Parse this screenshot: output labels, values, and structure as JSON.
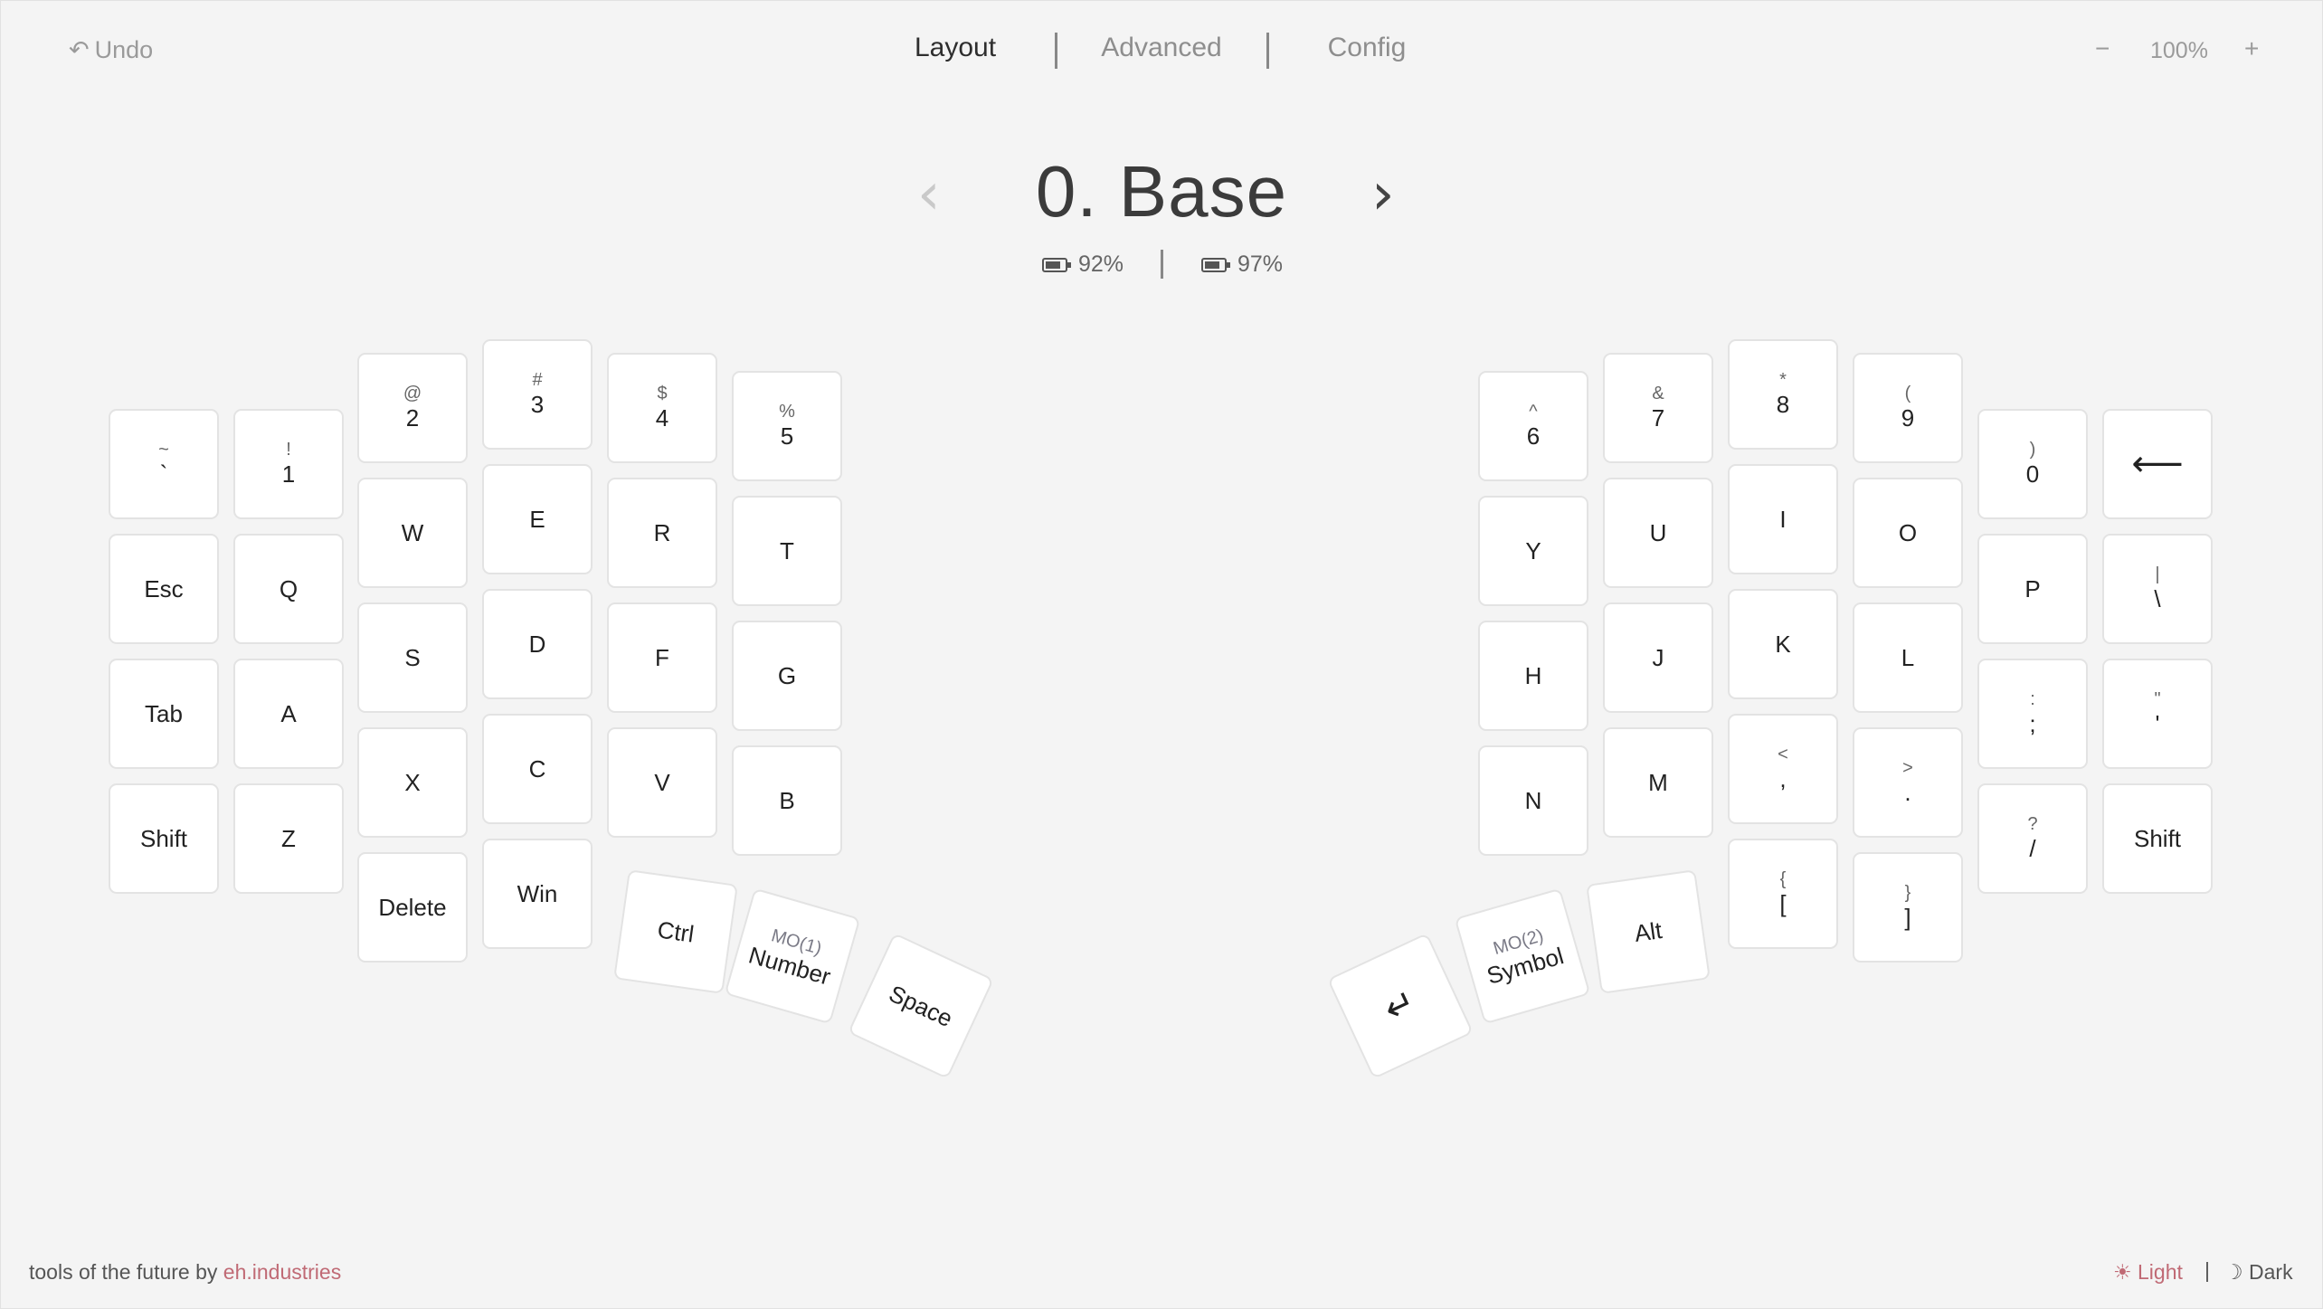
{
  "header": {
    "undo_icon": "↶",
    "undo_label": "Undo",
    "tabs": [
      {
        "label": "Layout",
        "active": true
      },
      {
        "label": "Advanced",
        "active": false
      },
      {
        "label": "Config",
        "active": false
      }
    ],
    "zoom": {
      "minus": "−",
      "value": "100%",
      "plus": "+"
    }
  },
  "layer": {
    "prev_icon": "‹",
    "next_icon": "›",
    "title": "0. Base",
    "battery_left": "92%",
    "battery_right": "97%"
  },
  "keys": {
    "left": [
      {
        "shift": "~",
        "primary": "`"
      },
      {
        "shift": "!",
        "primary": "1"
      },
      {
        "shift": "@",
        "primary": "2"
      },
      {
        "shift": "#",
        "primary": "3"
      },
      {
        "shift": "$",
        "primary": "4"
      },
      {
        "shift": "%",
        "primary": "5"
      },
      {
        "shift": "",
        "primary": "Esc"
      },
      {
        "shift": "",
        "primary": "Q"
      },
      {
        "shift": "",
        "primary": "W"
      },
      {
        "shift": "",
        "primary": "E"
      },
      {
        "shift": "",
        "primary": "R"
      },
      {
        "shift": "",
        "primary": "T"
      },
      {
        "shift": "",
        "primary": "Tab"
      },
      {
        "shift": "",
        "primary": "A"
      },
      {
        "shift": "",
        "primary": "S"
      },
      {
        "shift": "",
        "primary": "D"
      },
      {
        "shift": "",
        "primary": "F"
      },
      {
        "shift": "",
        "primary": "G"
      },
      {
        "shift": "",
        "primary": "Shift"
      },
      {
        "shift": "",
        "primary": "Z"
      },
      {
        "shift": "",
        "primary": "X"
      },
      {
        "shift": "",
        "primary": "C"
      },
      {
        "shift": "",
        "primary": "V"
      },
      {
        "shift": "",
        "primary": "B"
      },
      {
        "shift": "",
        "primary": "Delete"
      },
      {
        "shift": "",
        "primary": "Win"
      }
    ],
    "left_thumb": [
      {
        "shift": "",
        "primary": "Ctrl"
      },
      {
        "shift": "MO(1)",
        "primary": "Number"
      },
      {
        "shift": "",
        "primary": "Space"
      }
    ],
    "right": [
      {
        "shift": "^",
        "primary": "6"
      },
      {
        "shift": "&",
        "primary": "7"
      },
      {
        "shift": "*",
        "primary": "8"
      },
      {
        "shift": "(",
        "primary": "9"
      },
      {
        "shift": ")",
        "primary": "0"
      },
      {
        "shift": "",
        "primary": "⟵"
      },
      {
        "shift": "",
        "primary": "Y"
      },
      {
        "shift": "",
        "primary": "U"
      },
      {
        "shift": "",
        "primary": "I"
      },
      {
        "shift": "",
        "primary": "O"
      },
      {
        "shift": "",
        "primary": "P"
      },
      {
        "shift": "|",
        "primary": "\\"
      },
      {
        "shift": "",
        "primary": "H"
      },
      {
        "shift": "",
        "primary": "J"
      },
      {
        "shift": "",
        "primary": "K"
      },
      {
        "shift": "",
        "primary": "L"
      },
      {
        "shift": ":",
        "primary": ";"
      },
      {
        "shift": "\"",
        "primary": "'"
      },
      {
        "shift": "",
        "primary": "N"
      },
      {
        "shift": "",
        "primary": "M"
      },
      {
        "shift": "<",
        "primary": ","
      },
      {
        "shift": ">",
        "primary": "."
      },
      {
        "shift": "?",
        "primary": "/"
      },
      {
        "shift": "",
        "primary": "Shift"
      },
      {
        "shift": "{",
        "primary": "["
      },
      {
        "shift": "}",
        "primary": "]"
      }
    ],
    "right_thumb": [
      {
        "shift": "",
        "primary": "↵"
      },
      {
        "shift": "MO(2)",
        "primary": "Symbol"
      },
      {
        "shift": "",
        "primary": "Alt"
      }
    ]
  },
  "footer": {
    "tagline": "tools of the future by ",
    "brand": "eh.industries",
    "light_icon": "☀",
    "light_label": "Light",
    "separator": "|",
    "dark_icon": "☽",
    "dark_label": "Dark"
  },
  "colors": {
    "accent": "#c06a75",
    "background": "#f4f4f4",
    "key": "#ffffff"
  }
}
